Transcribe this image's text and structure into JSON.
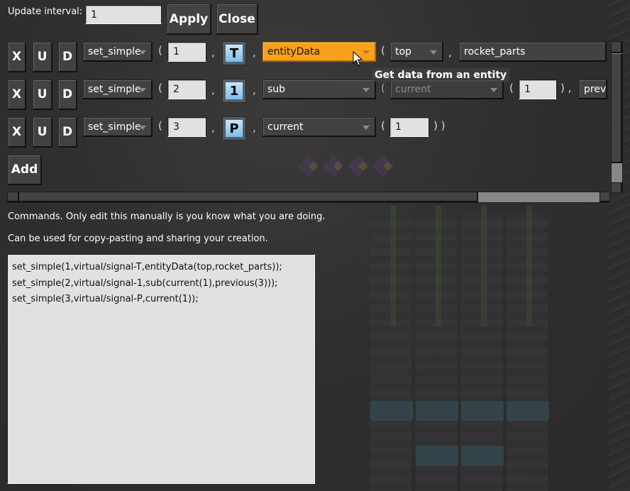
{
  "header": {
    "update_interval_label": "Update interval:",
    "update_interval_value": "1",
    "apply_label": "Apply",
    "close_label": "Close"
  },
  "rows": [
    {
      "x_label": "X",
      "u_label": "U",
      "d_label": "D",
      "function": "set_simple",
      "index": "1",
      "signal": "T",
      "op": "entityData",
      "args": [
        {
          "type": "dropdown",
          "value": "top"
        },
        {
          "type": "text",
          "value": "rocket_parts"
        }
      ]
    },
    {
      "x_label": "X",
      "u_label": "U",
      "d_label": "D",
      "function": "set_simple",
      "index": "2",
      "signal": "1",
      "op": "sub",
      "args": [
        {
          "type": "dropdown",
          "value": "current"
        },
        {
          "type": "text",
          "value": "1"
        },
        {
          "type": "dropdown",
          "value": "prev"
        }
      ]
    },
    {
      "x_label": "X",
      "u_label": "U",
      "d_label": "D",
      "function": "set_simple",
      "index": "3",
      "signal": "P",
      "op": "current",
      "args": [
        {
          "type": "text",
          "value": "1"
        }
      ]
    }
  ],
  "punct": {
    "open": "(",
    "comma": ",",
    "close": ")",
    "close_close": ") )",
    "close_comma": ") ,"
  },
  "tooltip": "Get data from an entity",
  "add_label": "Add",
  "help_line1": "Commands. Only edit this manually is you know what you are doing.",
  "help_line2": "Can be used for copy-pasting and sharing your creation.",
  "commands_text": "set_simple(1,virtual/signal-T,entityData(top,rocket_parts));\nset_simple(2,virtual/signal-1,sub(current(1),previous(3)));\nset_simple(3,virtual/signal-P,current(1));",
  "colors": {
    "panel": "#424244",
    "highlight_dropdown": "#f7a01c",
    "signal_icon": "#9ccdf0",
    "text_field": "#e1e1e1"
  }
}
